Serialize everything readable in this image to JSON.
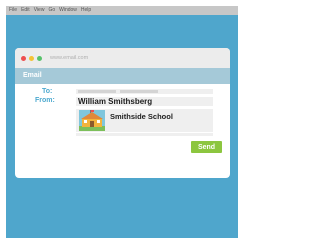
{
  "menubar": {
    "items": [
      "File",
      "Edit",
      "View",
      "Go",
      "Window",
      "Help"
    ]
  },
  "window": {
    "url": "www.email.com"
  },
  "email": {
    "header_label": "Email",
    "to_label": "To:",
    "to_value": "",
    "from_label": "From:",
    "from_value": "William Smithsberg",
    "signature_school": "Smithside School",
    "send_label": "Send"
  },
  "colors": {
    "background": "#4fa6cc",
    "email_header": "#a5c9d8",
    "label_accent": "#4da9cf",
    "send_button": "#8cc63f",
    "close_dot": "#ee4f4f",
    "minimize_dot": "#f4c335",
    "zoom_dot": "#57c26a"
  },
  "icons": {
    "school_logo": "school-logo-icon"
  }
}
